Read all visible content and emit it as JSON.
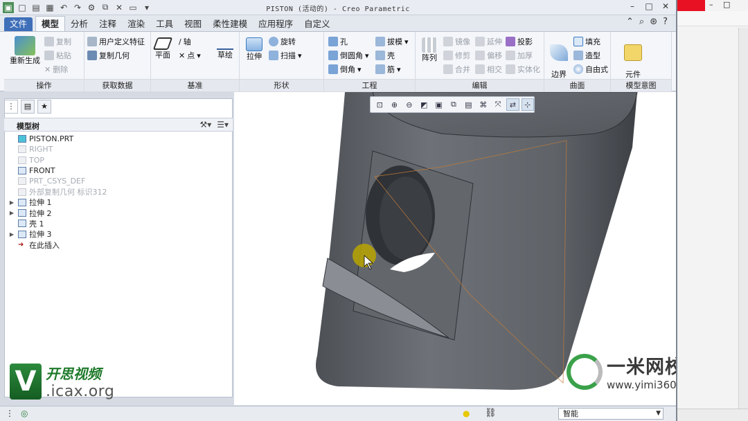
{
  "window": {
    "title": "PISTON (活动的) - Creo Parametric"
  },
  "tabs": [
    "文件",
    "模型",
    "分析",
    "注释",
    "渲染",
    "工具",
    "视图",
    "柔性建模",
    "应用程序",
    "自定义"
  ],
  "ribbon": {
    "operations": {
      "label": "操作",
      "regenerate": "重新生成",
      "copy": "复制",
      "paste": "粘贴",
      "delete": "删除"
    },
    "get_data": {
      "label": "获取数据",
      "udf": "用户定义特征",
      "copy_geom": "复制几何"
    },
    "datum": {
      "label": "基准",
      "plane": "平面",
      "axis": "轴",
      "point": "点",
      "sketch": "草绘"
    },
    "shapes": {
      "label": "形状",
      "extrude": "拉伸",
      "revolve": "旋转",
      "sweep": "扫描"
    },
    "engineering": {
      "label": "工程",
      "hole": "孔",
      "round": "倒圆角",
      "chamfer": "倒角",
      "draft": "拔模",
      "shell": "壳",
      "rib": "筋"
    },
    "editing": {
      "label": "编辑",
      "pattern": "阵列",
      "mirror": "镜像",
      "trim": "修剪",
      "merge": "合并",
      "extend": "延伸",
      "offset": "偏移",
      "intersect": "相交",
      "project": "投影",
      "thicken": "加厚",
      "solidify": "实体化"
    },
    "surfaces": {
      "label": "曲面",
      "boundary": "边界\n混合",
      "fill": "填充",
      "style": "造型",
      "freestyle": "自由式"
    },
    "model_intent": {
      "label": "模型意图",
      "component_interface": "元件\n界面"
    }
  },
  "model_tree": {
    "title": "模型树",
    "items": [
      {
        "label": "PISTON.PRT",
        "dim": false,
        "expand": ""
      },
      {
        "label": "RIGHT",
        "dim": true,
        "expand": ""
      },
      {
        "label": "TOP",
        "dim": true,
        "expand": ""
      },
      {
        "label": "FRONT",
        "dim": false,
        "expand": ""
      },
      {
        "label": "PRT_CSYS_DEF",
        "dim": true,
        "expand": ""
      },
      {
        "label": "外部复制几何 标识312",
        "dim": true,
        "expand": ""
      },
      {
        "label": "拉伸 1",
        "dim": false,
        "expand": "▶"
      },
      {
        "label": "拉伸 2",
        "dim": false,
        "expand": "▶"
      },
      {
        "label": "壳 1",
        "dim": false,
        "expand": ""
      },
      {
        "label": "拉伸 3",
        "dim": false,
        "expand": "▶"
      },
      {
        "label": "在此插入",
        "dim": false,
        "expand": ""
      }
    ]
  },
  "status": {
    "filter": "智能"
  },
  "watermark": {
    "left_cn": "开思视频",
    "left_url": ".icax.org",
    "right_brand": "一米网校",
    "right_site": "www.yimi360.com"
  },
  "colors": {
    "part": "#6c6f74",
    "file_tab": "#3f6fb8",
    "highlight": "#b8a400"
  }
}
